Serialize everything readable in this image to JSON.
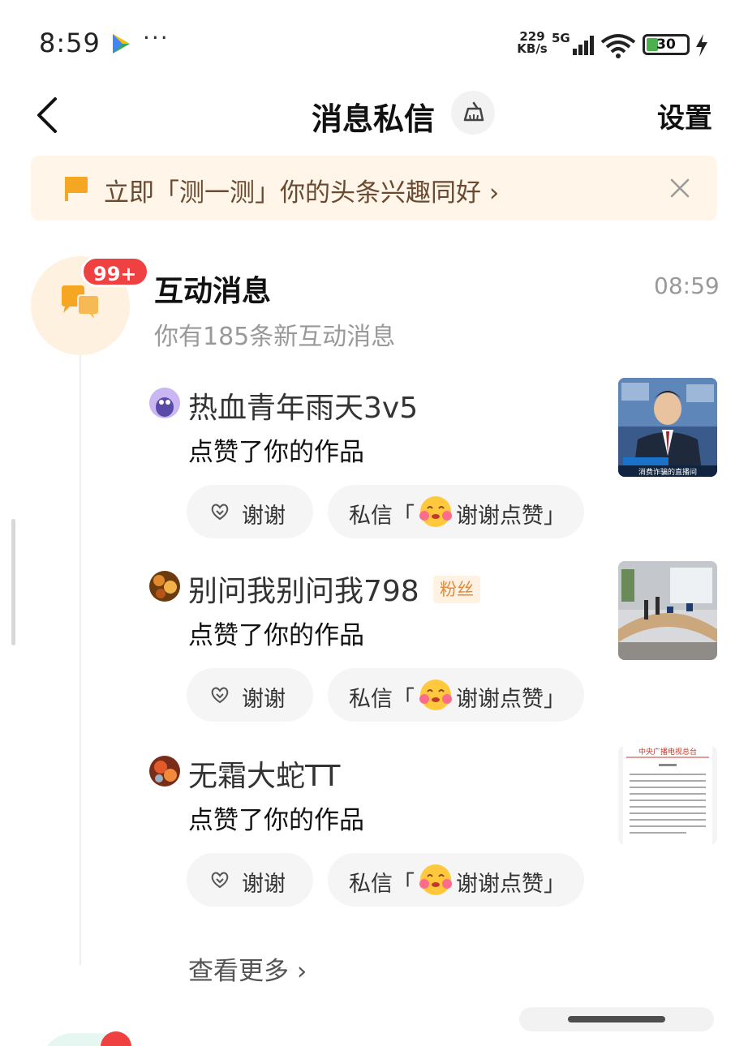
{
  "status_bar": {
    "time": "8:59",
    "net_speed_value": "229",
    "net_speed_unit": "KB/s",
    "network": "5G",
    "battery": "30",
    "battery_level": 0.3,
    "icons": [
      "play-icon",
      "more-dots-icon",
      "signal-icon",
      "wifi-icon",
      "battery-icon",
      "charging-icon"
    ]
  },
  "header": {
    "title": "消息私信",
    "settings_label": "设置",
    "icons": [
      "back-arrow-icon",
      "broom-icon"
    ]
  },
  "banner": {
    "text": "立即「测一测」你的头条兴趣同好 ›",
    "icons": [
      "flag-icon",
      "close-icon"
    ],
    "colors": {
      "background": "#fff5e8",
      "flag": "#f5a623"
    }
  },
  "interaction": {
    "badge": "99+",
    "title": "互动消息",
    "time": "08:59",
    "subtitle": "你有185条新互动消息",
    "colors": {
      "badge": "#f04142",
      "icon_bg": "#fff1e0",
      "icon": "#f5a623"
    },
    "items": [
      {
        "username": "热血青年雨天3v5",
        "fan_badge": "",
        "action": "点赞了你的作品",
        "thanks_label": "谢谢",
        "pm_label": "私信「",
        "pm_quote": "谢谢点赞」",
        "thumb_caption": "消费诈骗的直播间"
      },
      {
        "username": "别问我别问我798",
        "fan_badge": "粉丝",
        "action": "点赞了你的作品",
        "thanks_label": "谢谢",
        "pm_label": "私信「",
        "pm_quote": "谢谢点赞」"
      },
      {
        "username": "无霜大蛇TT",
        "fan_badge": "",
        "action": "点赞了你的作品",
        "thanks_label": "谢谢",
        "pm_label": "私信「",
        "pm_quote": "谢谢点赞」",
        "thumb_header": "中央广播电视总台"
      }
    ],
    "see_more": "查看更多 ›"
  }
}
